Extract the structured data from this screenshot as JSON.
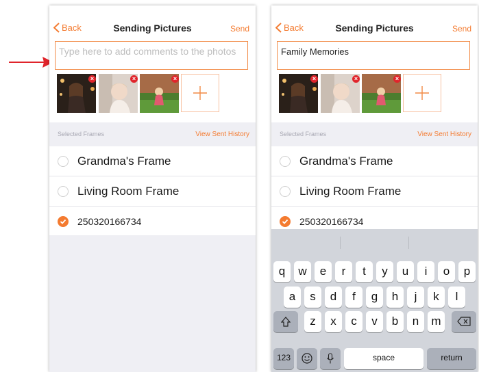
{
  "annotation": {
    "arrow_color": "#e0242b"
  },
  "accent_color": "#f47b30",
  "left": {
    "nav": {
      "back": "Back",
      "title": "Sending Pictures",
      "send": "Send"
    },
    "comment_placeholder": "Type here to add comments to the photos",
    "section_label": "Selected Frames",
    "history_link": "View Sent History",
    "frames": [
      {
        "name": "Grandma's Frame",
        "selected": false
      },
      {
        "name": "Living Room Frame",
        "selected": false
      },
      {
        "name": "250320166734",
        "selected": true
      }
    ]
  },
  "right": {
    "nav": {
      "back": "Back",
      "title": "Sending Pictures",
      "send": "Send"
    },
    "comment_text": "Family Memories",
    "section_label": "Selected Frames",
    "history_link": "View Sent History",
    "frames": [
      {
        "name": "Grandma's Frame",
        "selected": false
      },
      {
        "name": "Living Room Frame",
        "selected": false
      },
      {
        "name": "250320166734",
        "selected": true
      }
    ]
  },
  "photos": [
    {
      "icon": "photo-night-portrait",
      "remove": "×"
    },
    {
      "icon": "photo-toddler",
      "remove": "×"
    },
    {
      "icon": "photo-garden-child",
      "remove": "×"
    }
  ],
  "keyboard": {
    "row1": [
      "q",
      "w",
      "e",
      "r",
      "t",
      "y",
      "u",
      "i",
      "o",
      "p"
    ],
    "row2": [
      "a",
      "s",
      "d",
      "f",
      "g",
      "h",
      "j",
      "k",
      "l"
    ],
    "row3": [
      "z",
      "x",
      "c",
      "v",
      "b",
      "n",
      "m"
    ],
    "numbers_key": "123",
    "space_key": "space",
    "return_key": "return"
  }
}
